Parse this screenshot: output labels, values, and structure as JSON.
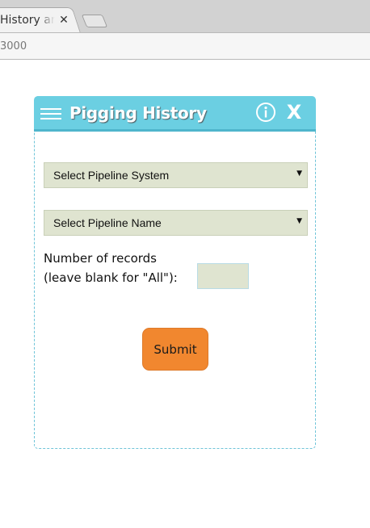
{
  "browser": {
    "tab_title": "History and",
    "close_tab_glyph": "✕",
    "url": "3000"
  },
  "panel": {
    "title": "Pigging History",
    "menu_icon": "hamburger-menu-icon",
    "info_icon": "info-icon",
    "close_label": "X",
    "pipeline_system_select": {
      "selected": "Select Pipeline System",
      "arrow": "▼"
    },
    "pipeline_name_select": {
      "selected": "Select Pipeline Name",
      "arrow": "▼"
    },
    "records": {
      "label_line1": "Number of records",
      "label_line2": "(leave blank for \"All\"):",
      "value": ""
    },
    "submit_label": "Submit"
  },
  "colors": {
    "header": "#6bcfe2",
    "select_bg": "#dfe4d0",
    "submit_bg": "#f1872f"
  }
}
